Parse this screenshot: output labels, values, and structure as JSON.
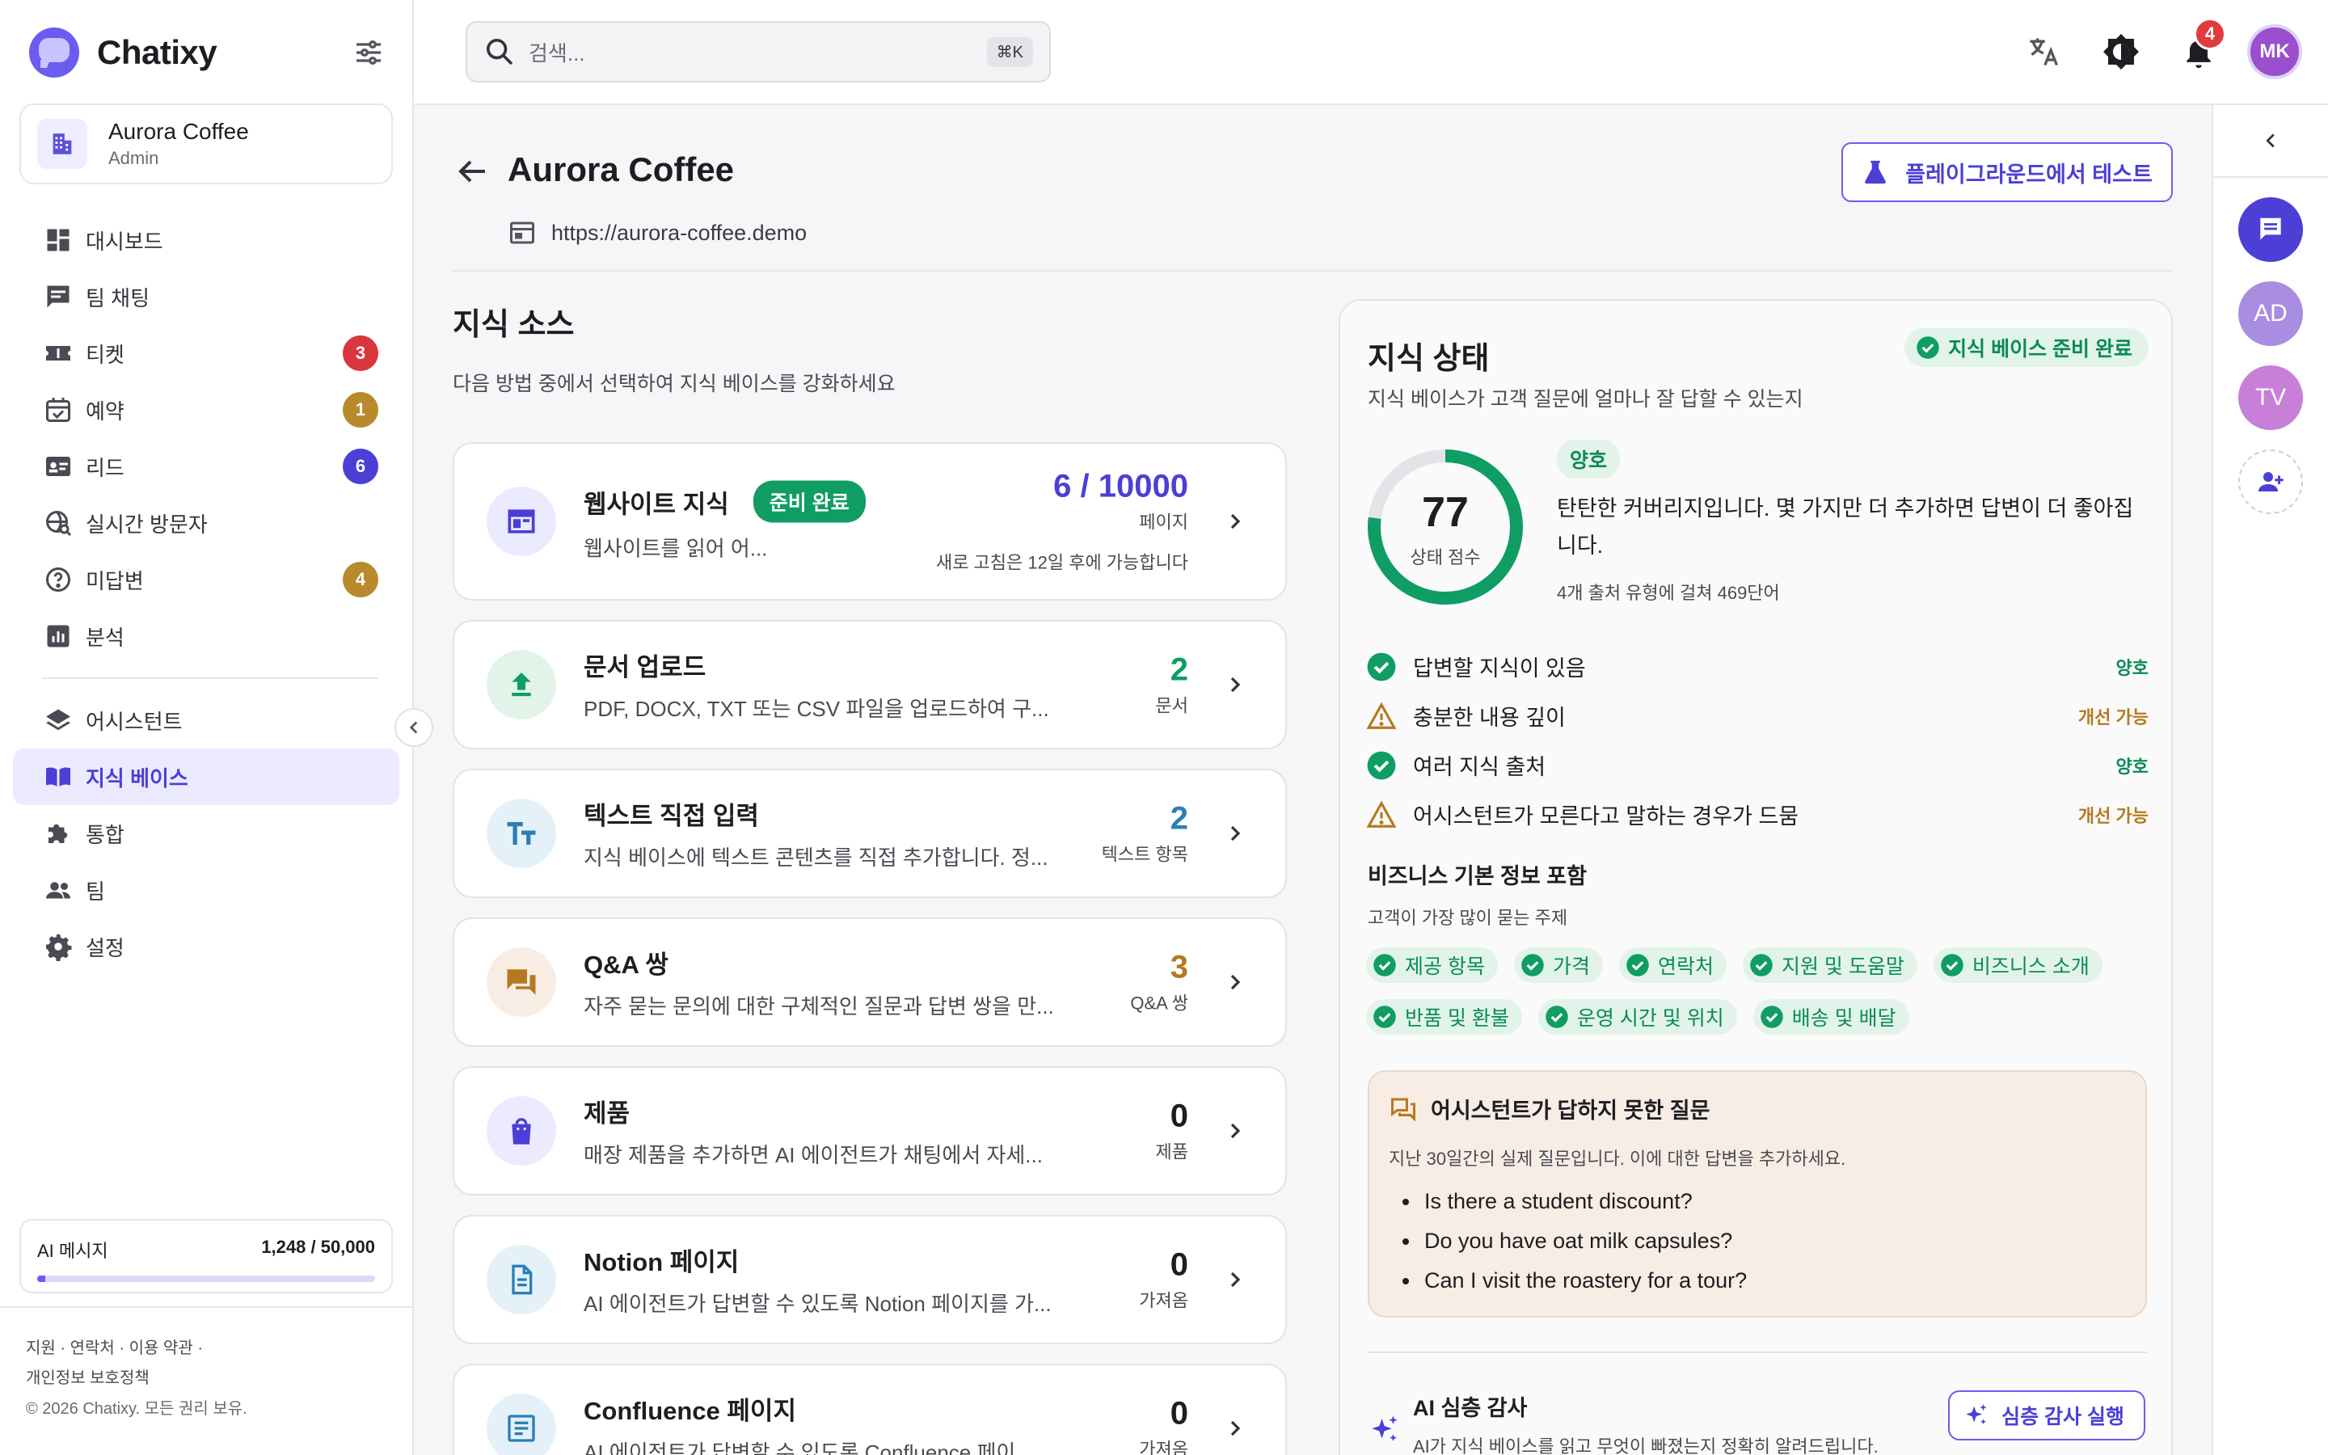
{
  "app": {
    "name": "Chatixy"
  },
  "org": {
    "name": "Aurora Coffee",
    "role": "Admin"
  },
  "nav": [
    {
      "label": "대시보드",
      "icon": "dashboard-icon"
    },
    {
      "label": "팀 채팅",
      "icon": "chat-icon"
    },
    {
      "label": "티켓",
      "icon": "ticket-icon",
      "badge": "3"
    },
    {
      "label": "예약",
      "icon": "calendar-icon",
      "badge": "1"
    },
    {
      "label": "리드",
      "icon": "contact-card-icon",
      "badge": "6"
    },
    {
      "label": "실시간 방문자",
      "icon": "live-visitors-icon"
    },
    {
      "label": "미답변",
      "icon": "help-circle-icon",
      "badge": "4"
    },
    {
      "label": "분석",
      "icon": "analytics-icon"
    },
    {
      "label": "어시스턴트",
      "icon": "layers-icon"
    },
    {
      "label": "지식 베이스",
      "icon": "book-icon"
    },
    {
      "label": "통합",
      "icon": "puzzle-icon"
    },
    {
      "label": "팀",
      "icon": "team-icon"
    },
    {
      "label": "설정",
      "icon": "gear-icon"
    }
  ],
  "colors": {
    "accent": "#6a5cf0",
    "success": "#0f9d64",
    "warning": "#b57a1f",
    "badge_red": "#e23b3b",
    "badge_gold": "#b98a2c",
    "badge_indigo": "#4b3fd6"
  },
  "quota": {
    "label": "AI 메시지",
    "value": "1,248 / 50,000",
    "fraction": 0.025
  },
  "footer": {
    "support": "지원",
    "contact": "연락처",
    "terms": "이용 약관",
    "privacy": "개인정보 보호정책",
    "copyright": "© 2026 Chatixy. 모든 권리 보유."
  },
  "search": {
    "placeholder": "검색...",
    "shortcut": "⌘K"
  },
  "topbar": {
    "notifications": "4",
    "avatar": "MK"
  },
  "rail": {
    "avatars": [
      "AD",
      "TV"
    ]
  },
  "page": {
    "title": "Aurora Coffee",
    "url": "https://aurora-coffee.demo",
    "playground_button": "플레이그라운드에서 테스트"
  },
  "sources": {
    "title": "지식 소스",
    "subtitle": "다음 방법 중에서 선택하여 지식 베이스를 강화하세요",
    "cards": [
      {
        "title": "웹사이트 지식",
        "desc": "웹사이트를 읽어 어...",
        "pill": "준비 완료",
        "count": "6 / 10000",
        "unit": "페이지",
        "note": "새로 고침은 12일 후에 가능합니다",
        "icon": "website-icon",
        "color": "#4b3fd6",
        "bg": "#eceaff"
      },
      {
        "title": "문서 업로드",
        "desc": "PDF, DOCX, TXT 또는 CSV 파일을 업로드하여 구...",
        "count": "2",
        "unit": "문서",
        "icon": "upload-icon",
        "color": "#0f9d64",
        "bg": "#e2f4ea"
      },
      {
        "title": "텍스트 직접 입력",
        "desc": "지식 베이스에 텍스트 콘텐츠를 직접 추가합니다. 정...",
        "count": "2",
        "unit": "텍스트 항목",
        "icon": "text-format-icon",
        "color": "#2a7fb5",
        "bg": "#e4f1f8"
      },
      {
        "title": "Q&A 쌍",
        "desc": "자주 묻는 문의에 대한 구체적인 질문과 답변 쌍을 만...",
        "count": "3",
        "unit": "Q&A 쌍",
        "icon": "qa-forum-icon",
        "color": "#b57a1f",
        "bg": "#f7ede4"
      },
      {
        "title": "제품",
        "desc": "매장 제품을 추가하면 AI 에이전트가 채팅에서 자세...",
        "count": "0",
        "unit": "제품",
        "icon": "shopping-bag-icon",
        "color": "#4b3fd6",
        "bg": "#eceaff"
      },
      {
        "title": "Notion 페이지",
        "desc": "AI 에이전트가 답변할 수 있도록 Notion 페이지를 가...",
        "count": "0",
        "unit": "가져옴",
        "icon": "document-icon",
        "color": "#2a7fb5",
        "bg": "#e4f1f8"
      },
      {
        "title": "Confluence 페이지",
        "desc": "AI 에이전트가 답변할 수 있도록 Confluence 페이...",
        "count": "0",
        "unit": "가져옴",
        "icon": "article-icon",
        "color": "#2a7fb5",
        "bg": "#e4f1f8"
      }
    ]
  },
  "status": {
    "title": "지식 상태",
    "subtitle": "지식 베이스가 고객 질문에 얼마나 잘 답할 수 있는지",
    "ready_badge": "지식 베이스 준비 완료",
    "score": "77",
    "score_value": 77,
    "score_label": "상태 점수",
    "grade": "양호",
    "description": "탄탄한 커버리지입니다. 몇 가지만 더 추가하면 답변이 더 좋아집니다.",
    "words": "4개 출처 유형에 걸쳐 469단어",
    "checks": [
      {
        "label": "답변할 지식이 있음",
        "state": "양호",
        "ok": true
      },
      {
        "label": "충분한 내용 깊이",
        "state": "개선 가능",
        "ok": false
      },
      {
        "label": "여러 지식 출처",
        "state": "양호",
        "ok": true
      },
      {
        "label": "어시스턴트가 모른다고 말하는 경우가 드뭄",
        "state": "개선 가능",
        "ok": false
      }
    ],
    "biz_title": "비즈니스 기본 정보 포함",
    "biz_sub": "고객이 가장 많이 묻는 주제",
    "chips": [
      "제공 항목",
      "가격",
      "연락처",
      "지원 및 도움말",
      "비즈니스 소개",
      "반품 및 환불",
      "운영 시간 및 위치",
      "배송 및 배달"
    ],
    "unanswered_title": "어시스턴트가 답하지 못한 질문",
    "unanswered_sub": "지난 30일간의 실제 질문입니다. 이에 대한 답변을 추가하세요.",
    "unanswered": [
      "Is there a student discount?",
      "Do you have oat milk capsules?",
      "Can I visit the roastery for a tour?"
    ],
    "audit_title": "AI 심층 감사",
    "audit_sub": "AI가 지식 베이스를 읽고 무엇이 빠졌는지 정확히 알려드립니다.",
    "audit_button": "심층 감사 실행"
  }
}
